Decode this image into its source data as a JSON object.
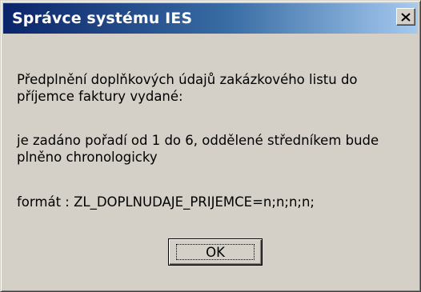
{
  "window": {
    "title": "Správce systému IES",
    "close_icon": "close-icon"
  },
  "message": {
    "paragraph1": "Předplnění doplňkových údajů zakázkového listu do příjemce faktury vydané:",
    "paragraph2": "je zadáno pořadí od 1 do 6, oddělené středníkem bude plněno chronologicky",
    "paragraph3": "formát : ZL_DOPLNUDAJE_PRIJEMCE=n;n;n;n;"
  },
  "buttons": {
    "ok_label": "OK"
  },
  "colors": {
    "title_gradient_start": "#0a246a",
    "title_gradient_end": "#a6caf0",
    "dialog_face": "#d4d0c8"
  }
}
